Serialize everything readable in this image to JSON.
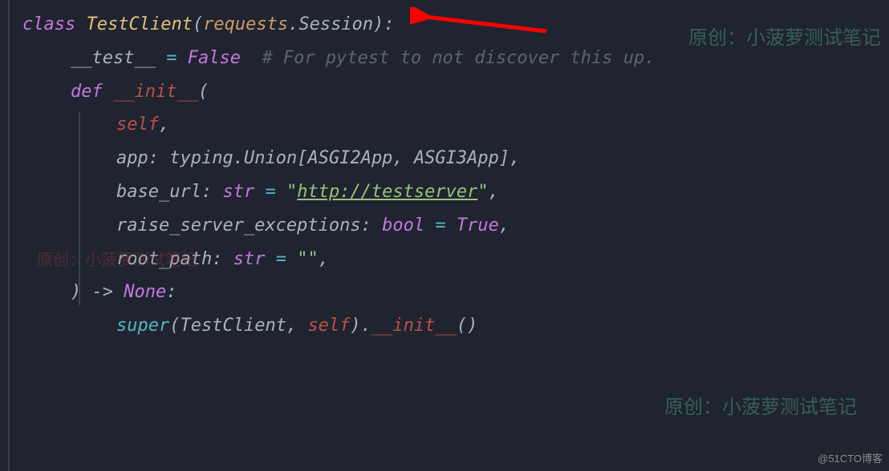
{
  "code": {
    "line1": {
      "kw": "class",
      "name": "TestClient",
      "paren_open": "(",
      "base1": "requests",
      "dot": ".",
      "base2": "Session",
      "paren_close": ")",
      "colon": ":"
    },
    "line2": {
      "attr": "__test__",
      "eq": " = ",
      "val": "False",
      "comment": "  # For pytest to not discover this up."
    },
    "line3": {
      "blank": ""
    },
    "line4": {
      "kw": "def",
      "name": "__init__",
      "paren": "("
    },
    "line5": {
      "self": "self",
      "comma": ","
    },
    "line6": {
      "param": "app",
      "colon": ": ",
      "type_prefix": "typing",
      "dot": ".",
      "type_name": "Union",
      "bracket_open": "[",
      "arg1": "ASGI2App",
      "sep": ", ",
      "arg2": "ASGI3App",
      "bracket_close": "]",
      "comma": ","
    },
    "line7": {
      "param": "base_url",
      "colon": ": ",
      "type": "str",
      "eq": " = ",
      "q1": "\"",
      "url": "http://testserver",
      "q2": "\"",
      "comma": ","
    },
    "line8": {
      "param": "raise_server_exceptions",
      "colon": ": ",
      "type": "bool",
      "eq": " = ",
      "val": "True",
      "comma": ","
    },
    "line9": {
      "param": "root_path",
      "colon": ": ",
      "type": "str",
      "eq": " = ",
      "val": "\"\"",
      "comma": ","
    },
    "line10": {
      "paren": ")",
      "arrow": " -> ",
      "ret": "None",
      "colon": ":"
    },
    "line11": {
      "super": "super",
      "paren_open": "(",
      "cls": "TestClient",
      "sep": ", ",
      "self": "self",
      "paren_close": ")",
      "dot": ".",
      "method": "__init__",
      "call": "()"
    }
  },
  "watermarks": {
    "top_right": "原创：小菠萝测试笔记",
    "mid_left": "原创：小菠萝测试笔记",
    "bottom_right": "原创：小菠萝测试笔记"
  },
  "attribution": "@51CTO博客"
}
